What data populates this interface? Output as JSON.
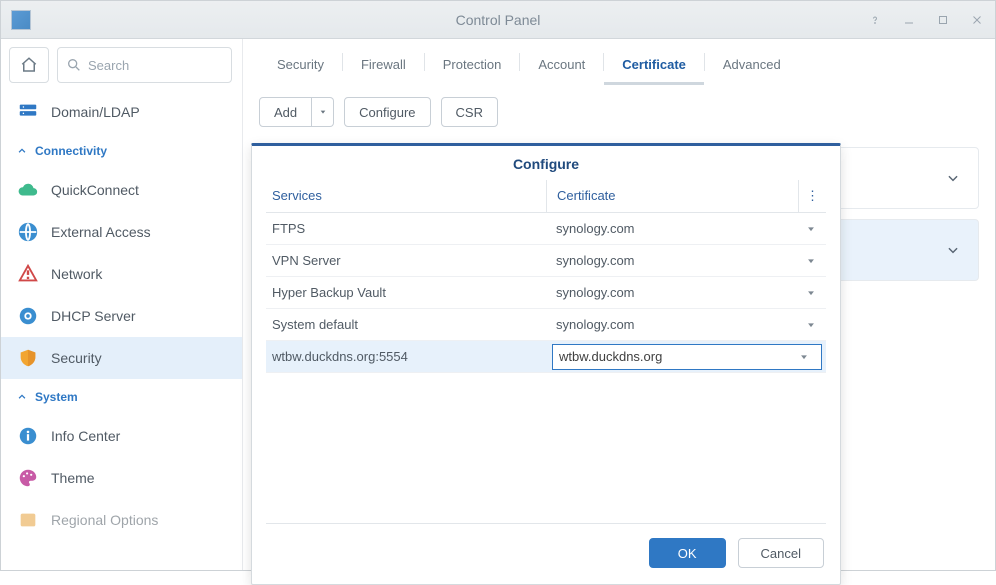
{
  "window": {
    "title": "Control Panel"
  },
  "search": {
    "placeholder": "Search"
  },
  "sidebar": {
    "top_item": {
      "label": "Domain/LDAP"
    },
    "sections": [
      {
        "name": "Connectivity",
        "items": [
          {
            "id": "quickconnect",
            "label": "QuickConnect"
          },
          {
            "id": "external-access",
            "label": "External Access"
          },
          {
            "id": "network",
            "label": "Network"
          },
          {
            "id": "dhcp-server",
            "label": "DHCP Server"
          },
          {
            "id": "security",
            "label": "Security"
          }
        ]
      },
      {
        "name": "System",
        "items": [
          {
            "id": "info-center",
            "label": "Info Center"
          },
          {
            "id": "theme",
            "label": "Theme"
          },
          {
            "id": "regional-options",
            "label": "Regional Options"
          }
        ]
      }
    ]
  },
  "tabs": [
    {
      "label": "Security"
    },
    {
      "label": "Firewall"
    },
    {
      "label": "Protection"
    },
    {
      "label": "Account"
    },
    {
      "label": "Certificate"
    },
    {
      "label": "Advanced"
    }
  ],
  "active_tab": "Certificate",
  "toolbar": {
    "add": "Add",
    "configure": "Configure",
    "csr": "CSR"
  },
  "dialog": {
    "title": "Configure",
    "columns": {
      "services": "Services",
      "certificate": "Certificate"
    },
    "rows": [
      {
        "service": "FTPS",
        "cert": "synology.com"
      },
      {
        "service": "VPN Server",
        "cert": "synology.com"
      },
      {
        "service": "Hyper Backup Vault",
        "cert": "synology.com"
      },
      {
        "service": "System default",
        "cert": "synology.com"
      },
      {
        "service": "wtbw.duckdns.org:5554",
        "cert": "wtbw.duckdns.org"
      }
    ],
    "active_row_index": 4,
    "ok": "OK",
    "cancel": "Cancel"
  }
}
